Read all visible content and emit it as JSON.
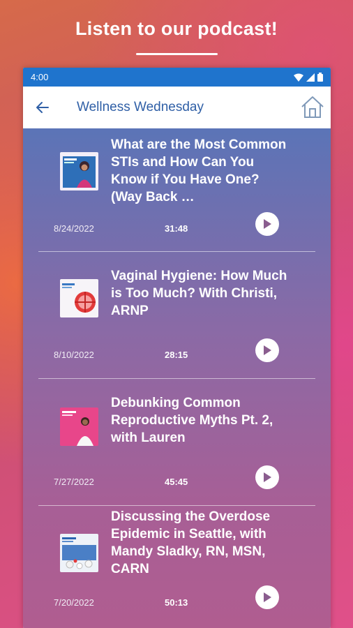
{
  "promo": {
    "headline": "Listen to our podcast!"
  },
  "status_bar": {
    "time": "4:00"
  },
  "app_bar": {
    "title": "Wellness Wednesday"
  },
  "episodes": [
    {
      "title": "What are the Most Common STIs and How Can You Know if You Have One? (Way Back …",
      "date": "8/24/2022",
      "duration": "31:48"
    },
    {
      "title": "Vaginal Hygiene: How Much is Too Much? With Christi, ARNP",
      "date": "8/10/2022",
      "duration": "28:15"
    },
    {
      "title": "Debunking Common Reproductive Myths Pt. 2, with Lauren",
      "date": "7/27/2022",
      "duration": "45:45"
    },
    {
      "title": "Discussing the Overdose Epidemic in Seattle, with Mandy Sladky, RN, MSN, CARN",
      "date": "7/20/2022",
      "duration": "50:13"
    }
  ],
  "colors": {
    "status_bar": "#1f74cd",
    "app_title": "#2f5fa6"
  },
  "icons": {
    "back": "arrow-left-icon",
    "home": "home-icon",
    "play": "play-icon"
  }
}
